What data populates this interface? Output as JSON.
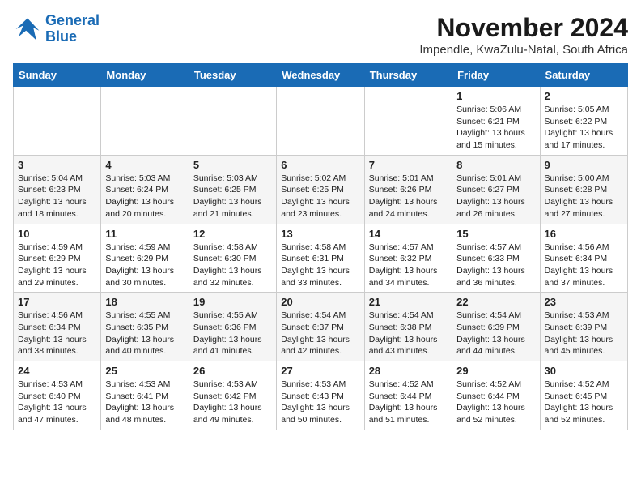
{
  "logo": {
    "line1": "General",
    "line2": "Blue"
  },
  "title": "November 2024",
  "subtitle": "Impendle, KwaZulu-Natal, South Africa",
  "weekdays": [
    "Sunday",
    "Monday",
    "Tuesday",
    "Wednesday",
    "Thursday",
    "Friday",
    "Saturday"
  ],
  "weeks": [
    [
      {
        "day": "",
        "info": ""
      },
      {
        "day": "",
        "info": ""
      },
      {
        "day": "",
        "info": ""
      },
      {
        "day": "",
        "info": ""
      },
      {
        "day": "",
        "info": ""
      },
      {
        "day": "1",
        "info": "Sunrise: 5:06 AM\nSunset: 6:21 PM\nDaylight: 13 hours and 15 minutes."
      },
      {
        "day": "2",
        "info": "Sunrise: 5:05 AM\nSunset: 6:22 PM\nDaylight: 13 hours and 17 minutes."
      }
    ],
    [
      {
        "day": "3",
        "info": "Sunrise: 5:04 AM\nSunset: 6:23 PM\nDaylight: 13 hours and 18 minutes."
      },
      {
        "day": "4",
        "info": "Sunrise: 5:03 AM\nSunset: 6:24 PM\nDaylight: 13 hours and 20 minutes."
      },
      {
        "day": "5",
        "info": "Sunrise: 5:03 AM\nSunset: 6:25 PM\nDaylight: 13 hours and 21 minutes."
      },
      {
        "day": "6",
        "info": "Sunrise: 5:02 AM\nSunset: 6:25 PM\nDaylight: 13 hours and 23 minutes."
      },
      {
        "day": "7",
        "info": "Sunrise: 5:01 AM\nSunset: 6:26 PM\nDaylight: 13 hours and 24 minutes."
      },
      {
        "day": "8",
        "info": "Sunrise: 5:01 AM\nSunset: 6:27 PM\nDaylight: 13 hours and 26 minutes."
      },
      {
        "day": "9",
        "info": "Sunrise: 5:00 AM\nSunset: 6:28 PM\nDaylight: 13 hours and 27 minutes."
      }
    ],
    [
      {
        "day": "10",
        "info": "Sunrise: 4:59 AM\nSunset: 6:29 PM\nDaylight: 13 hours and 29 minutes."
      },
      {
        "day": "11",
        "info": "Sunrise: 4:59 AM\nSunset: 6:29 PM\nDaylight: 13 hours and 30 minutes."
      },
      {
        "day": "12",
        "info": "Sunrise: 4:58 AM\nSunset: 6:30 PM\nDaylight: 13 hours and 32 minutes."
      },
      {
        "day": "13",
        "info": "Sunrise: 4:58 AM\nSunset: 6:31 PM\nDaylight: 13 hours and 33 minutes."
      },
      {
        "day": "14",
        "info": "Sunrise: 4:57 AM\nSunset: 6:32 PM\nDaylight: 13 hours and 34 minutes."
      },
      {
        "day": "15",
        "info": "Sunrise: 4:57 AM\nSunset: 6:33 PM\nDaylight: 13 hours and 36 minutes."
      },
      {
        "day": "16",
        "info": "Sunrise: 4:56 AM\nSunset: 6:34 PM\nDaylight: 13 hours and 37 minutes."
      }
    ],
    [
      {
        "day": "17",
        "info": "Sunrise: 4:56 AM\nSunset: 6:34 PM\nDaylight: 13 hours and 38 minutes."
      },
      {
        "day": "18",
        "info": "Sunrise: 4:55 AM\nSunset: 6:35 PM\nDaylight: 13 hours and 40 minutes."
      },
      {
        "day": "19",
        "info": "Sunrise: 4:55 AM\nSunset: 6:36 PM\nDaylight: 13 hours and 41 minutes."
      },
      {
        "day": "20",
        "info": "Sunrise: 4:54 AM\nSunset: 6:37 PM\nDaylight: 13 hours and 42 minutes."
      },
      {
        "day": "21",
        "info": "Sunrise: 4:54 AM\nSunset: 6:38 PM\nDaylight: 13 hours and 43 minutes."
      },
      {
        "day": "22",
        "info": "Sunrise: 4:54 AM\nSunset: 6:39 PM\nDaylight: 13 hours and 44 minutes."
      },
      {
        "day": "23",
        "info": "Sunrise: 4:53 AM\nSunset: 6:39 PM\nDaylight: 13 hours and 45 minutes."
      }
    ],
    [
      {
        "day": "24",
        "info": "Sunrise: 4:53 AM\nSunset: 6:40 PM\nDaylight: 13 hours and 47 minutes."
      },
      {
        "day": "25",
        "info": "Sunrise: 4:53 AM\nSunset: 6:41 PM\nDaylight: 13 hours and 48 minutes."
      },
      {
        "day": "26",
        "info": "Sunrise: 4:53 AM\nSunset: 6:42 PM\nDaylight: 13 hours and 49 minutes."
      },
      {
        "day": "27",
        "info": "Sunrise: 4:53 AM\nSunset: 6:43 PM\nDaylight: 13 hours and 50 minutes."
      },
      {
        "day": "28",
        "info": "Sunrise: 4:52 AM\nSunset: 6:44 PM\nDaylight: 13 hours and 51 minutes."
      },
      {
        "day": "29",
        "info": "Sunrise: 4:52 AM\nSunset: 6:44 PM\nDaylight: 13 hours and 52 minutes."
      },
      {
        "day": "30",
        "info": "Sunrise: 4:52 AM\nSunset: 6:45 PM\nDaylight: 13 hours and 52 minutes."
      }
    ]
  ]
}
